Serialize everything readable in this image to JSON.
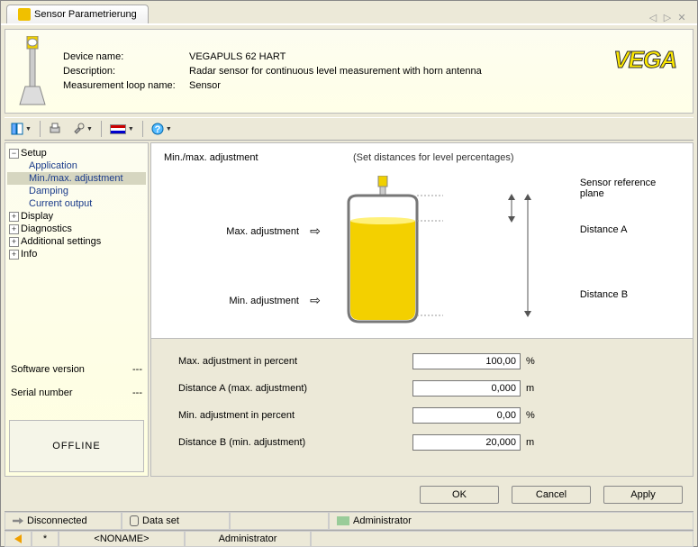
{
  "tab": {
    "title": "Sensor Parametrierung"
  },
  "header": {
    "labels": {
      "device_name": "Device name:",
      "description": "Description:",
      "loop_name": "Measurement loop name:"
    },
    "values": {
      "device_name": "VEGAPULS 62 HART",
      "description": "Radar sensor for continuous level measurement with horn antenna",
      "loop_name": "Sensor"
    },
    "brand": "VEGA"
  },
  "tree": {
    "setup": "Setup",
    "items": [
      "Application",
      "Min./max. adjustment",
      "Damping",
      "Current output"
    ],
    "display": "Display",
    "diagnostics": "Diagnostics",
    "additional": "Additional settings",
    "info": "Info",
    "sw_label": "Software version",
    "sw_val": "---",
    "sn_label": "Serial number",
    "sn_val": "---",
    "offline": "OFFLINE"
  },
  "content": {
    "title": "Min./max. adjustment",
    "hint": "(Set distances for level percentages)",
    "diagram": {
      "ref_plane": "Sensor reference plane",
      "max_adj": "Max. adjustment",
      "dist_a": "Distance A",
      "min_adj": "Min. adjustment",
      "dist_b": "Distance B"
    },
    "fields": {
      "max_pct_l": "Max. adjustment in percent",
      "max_pct_v": "100,00",
      "max_pct_u": "%",
      "dist_a_l": "Distance A (max. adjustment)",
      "dist_a_v": "0,000",
      "dist_a_u": "m",
      "min_pct_l": "Min. adjustment in percent",
      "min_pct_v": "0,00",
      "min_pct_u": "%",
      "dist_b_l": "Distance B (min. adjustment)",
      "dist_b_v": "20,000",
      "dist_b_u": "m"
    }
  },
  "buttons": {
    "ok": "OK",
    "cancel": "Cancel",
    "apply": "Apply"
  },
  "status1": {
    "disconnected": "Disconnected",
    "dataset": "Data set",
    "admin": "Administrator"
  },
  "status2": {
    "noname": "<NONAME>",
    "admin": "Administrator",
    "star": "*"
  }
}
